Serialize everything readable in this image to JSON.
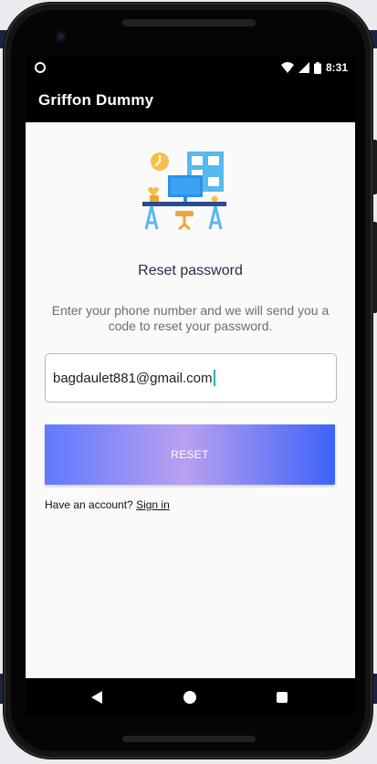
{
  "status_bar": {
    "time": "8:31",
    "icons": [
      "wifi-icon",
      "signal-icon",
      "battery-icon"
    ]
  },
  "app_bar": {
    "title": "Griffon Dummy"
  },
  "reset": {
    "heading": "Reset password",
    "description": "Enter your phone number and we will send you a code to reset your password.",
    "input_value": "bagdaulet881@gmail.com",
    "button_label": "RESET",
    "account_prompt": "Have an account?",
    "sign_in_label": "Sign in"
  },
  "navigation": {
    "icons": [
      "back-icon",
      "home-icon",
      "recents-icon"
    ]
  },
  "colors": {
    "app_bar": "#000000",
    "heading": "#1f2d4a",
    "button_gradient": [
      "#5f79ff",
      "#b9a0f0",
      "#3d63f8"
    ],
    "caret": "#13b8a6"
  }
}
